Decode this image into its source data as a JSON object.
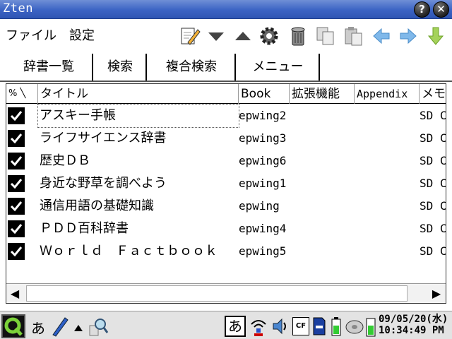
{
  "window": {
    "title": "Zten",
    "help_label": "?",
    "close_label": "✕"
  },
  "menu": {
    "file": "ファイル",
    "settings": "設定"
  },
  "tabs": [
    {
      "label": "辞書一覧"
    },
    {
      "label": "検索"
    },
    {
      "label": "複合検索"
    },
    {
      "label": "メニュー"
    }
  ],
  "table": {
    "headers": {
      "enabled": "% ╲",
      "title": "タイトル",
      "book": "Book",
      "extension": "拡張機能",
      "appendix": "Appendix",
      "memo": "メモ"
    },
    "rows": [
      {
        "title": "アスキー手帳",
        "book": "epwing2",
        "memo": "SD C"
      },
      {
        "title": "ライフサイエンス辞書",
        "book": "epwing3",
        "memo": "SD C"
      },
      {
        "title": "歴史ＤＢ",
        "book": "epwing6",
        "memo": "SD C"
      },
      {
        "title": "身近な野草を調べよう",
        "book": "epwing1",
        "memo": "SD C"
      },
      {
        "title": "通信用語の基礎知識",
        "book": "epwing",
        "memo": "SD C"
      },
      {
        "title": "ＰＤＤ百科辞書",
        "book": "epwing4",
        "memo": "SD C"
      },
      {
        "title": "Ｗｏｒｌｄ　Ｆａｃｔｂｏｏｋ",
        "book": "epwing5",
        "memo": "SD C"
      }
    ]
  },
  "taskbar": {
    "ime_label": "あ",
    "ime_indicator": "あ",
    "card_label": "CF",
    "date": "09/05/20(水)",
    "time": "10:34:49 PM"
  },
  "colors": {
    "titlebar": "#3b63c4",
    "arrow": "#5aa0e0",
    "download_arrow": "#8cc43c",
    "battery": "#33cc33"
  }
}
